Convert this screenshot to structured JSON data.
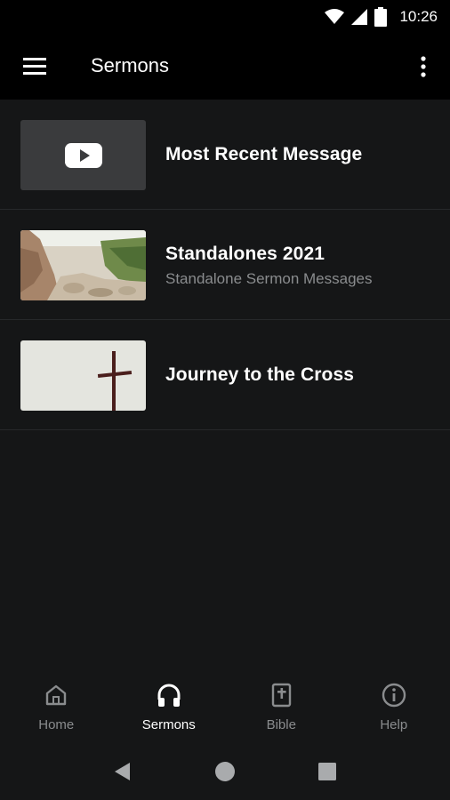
{
  "status": {
    "time": "10:26"
  },
  "appbar": {
    "title": "Sermons",
    "menu_icon": "hamburger-icon",
    "overflow_icon": "more-vert-icon"
  },
  "list": [
    {
      "title": "Most Recent Message",
      "subtitle": "",
      "thumb": "youtube-thumbnail"
    },
    {
      "title": "Standalones 2021",
      "subtitle": "Standalone Sermon Messages",
      "thumb": "canyon-photo"
    },
    {
      "title": "Journey to the Cross",
      "subtitle": "",
      "thumb": "cross-photo"
    }
  ],
  "bottom_nav": [
    {
      "label": "Home",
      "icon": "home-icon",
      "active": false
    },
    {
      "label": "Sermons",
      "icon": "headphones-icon",
      "active": true
    },
    {
      "label": "Bible",
      "icon": "bible-icon",
      "active": false
    },
    {
      "label": "Help",
      "icon": "info-icon",
      "active": false
    }
  ],
  "colors": {
    "background": "#151617",
    "bar": "#000000",
    "muted": "#8a8c8e",
    "divider": "#26282a"
  }
}
